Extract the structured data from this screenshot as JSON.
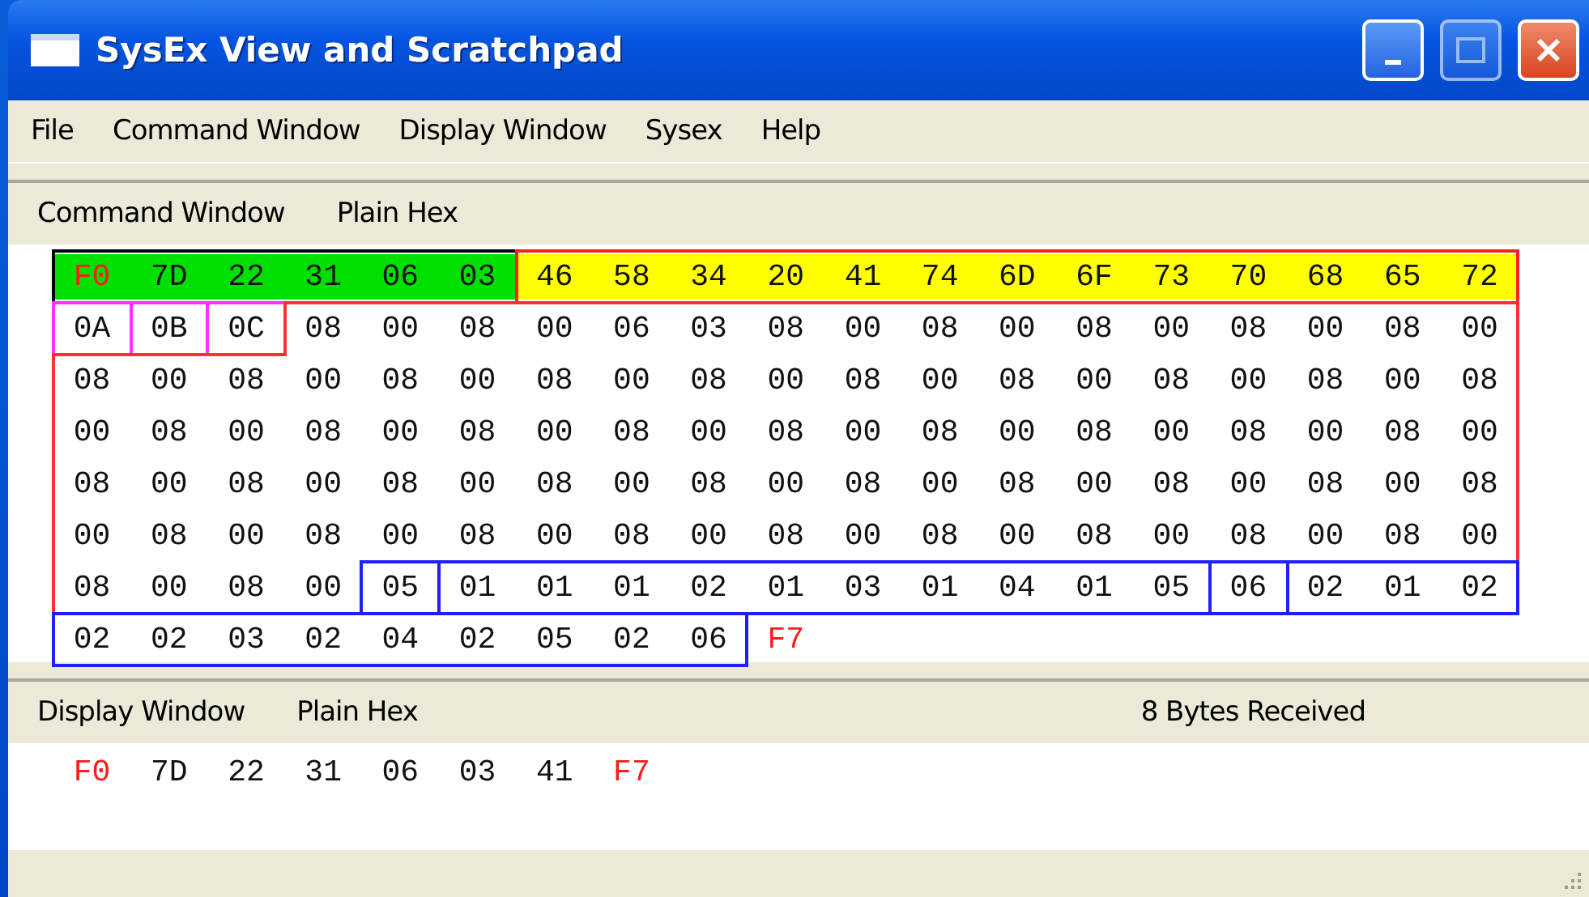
{
  "window": {
    "title": "SysEx View and Scratchpad"
  },
  "menu": [
    {
      "label": "File"
    },
    {
      "label": "Command Window"
    },
    {
      "label": "Display Window"
    },
    {
      "label": "Sysex"
    },
    {
      "label": "Help"
    }
  ],
  "command_panel": {
    "title": "Command Window",
    "format": "Plain Hex",
    "groups": [
      {
        "kind": "header",
        "status_byte": "F0",
        "bytes": [
          "7D",
          "22",
          "31",
          "06",
          "03"
        ]
      },
      {
        "kind": "name",
        "bytes": [
          "46",
          "58",
          "34",
          "20",
          "41",
          "74",
          "6D",
          "6F",
          "73",
          "70",
          "68",
          "65",
          "72"
        ]
      },
      {
        "kind": "index",
        "bytes": [
          "0A"
        ]
      },
      {
        "kind": "index",
        "bytes": [
          "0B"
        ]
      },
      {
        "kind": "index",
        "bytes": [
          "0C"
        ]
      },
      {
        "kind": "data",
        "bytes": [
          "08",
          "00",
          "08",
          "00",
          "06",
          "03",
          "08",
          "00",
          "08",
          "00",
          "08",
          "00",
          "08",
          "00",
          "08",
          "00",
          "08",
          "00",
          "08",
          "00",
          "08",
          "00",
          "08",
          "00",
          "08",
          "00",
          "08",
          "00",
          "08",
          "00",
          "08",
          "00",
          "08",
          "00",
          "08",
          "00",
          "08",
          "00",
          "08",
          "00",
          "08",
          "00",
          "08",
          "00",
          "08",
          "00",
          "08",
          "00",
          "08",
          "00",
          "08",
          "00",
          "08",
          "00",
          "08",
          "00",
          "08",
          "00",
          "08",
          "00",
          "08",
          "00",
          "08",
          "00",
          "08",
          "00",
          "08",
          "00",
          "08",
          "00",
          "08",
          "00",
          "08",
          "00",
          "08",
          "00",
          "08",
          "00",
          "08",
          "00",
          "08",
          "00",
          "08",
          "00",
          "08",
          "00",
          "08",
          "00",
          "08",
          "00",
          "08",
          "00",
          "08",
          "00",
          "08",
          "00"
        ]
      },
      {
        "kind": "count",
        "bytes": [
          "05"
        ]
      },
      {
        "kind": "values",
        "bytes": [
          "01",
          "01",
          "01",
          "02",
          "01",
          "03",
          "01",
          "04",
          "01",
          "05"
        ]
      },
      {
        "kind": "count",
        "bytes": [
          "06"
        ]
      },
      {
        "kind": "values",
        "bytes": [
          "02",
          "01",
          "02",
          "02",
          "02",
          "03",
          "02",
          "04",
          "02",
          "05",
          "02",
          "06"
        ]
      },
      {
        "kind": "end",
        "status_byte": "F7"
      }
    ]
  },
  "display_panel": {
    "title": "Display Window",
    "format": "Plain Hex",
    "count": "8  Bytes Received",
    "bytes": [
      {
        "text": "F0",
        "status": true
      },
      {
        "text": "7D",
        "status": false
      },
      {
        "text": "22",
        "status": false
      },
      {
        "text": "31",
        "status": false
      },
      {
        "text": "06",
        "status": false
      },
      {
        "text": "03",
        "status": false
      },
      {
        "text": "41",
        "status": false
      },
      {
        "text": "F7",
        "status": true
      }
    ]
  }
}
